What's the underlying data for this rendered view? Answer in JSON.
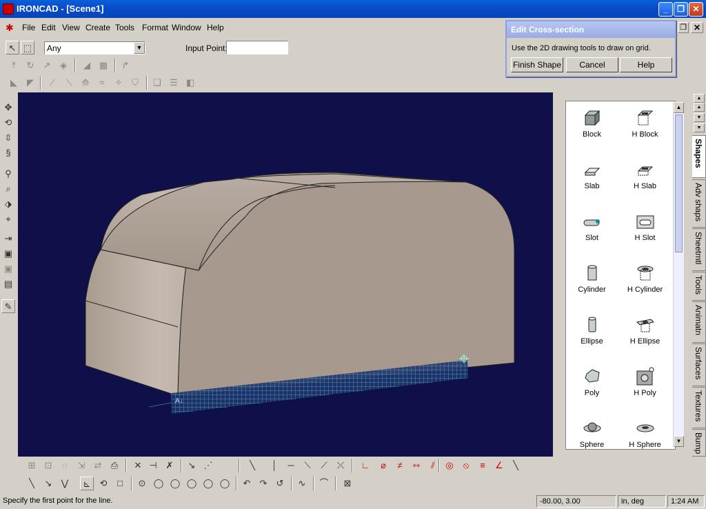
{
  "window": {
    "title": "IRONCAD - [Scene1]",
    "min_icon": "minimize-icon",
    "max_icon": "restore-icon",
    "close_icon": "close-icon"
  },
  "menu": [
    "File",
    "Edit",
    "View",
    "Create",
    "Tools",
    "Format",
    "Window",
    "Help"
  ],
  "selection": {
    "filter_value": "Any",
    "input_point_label": "Input Point:",
    "input_point_value": ""
  },
  "dialog": {
    "title": "Edit Cross-section",
    "message": "Use the 2D drawing tools to draw on grid.",
    "buttons": [
      "Finish Shape",
      "Cancel",
      "Help"
    ]
  },
  "catalog": {
    "items": [
      {
        "label": "Block",
        "icon": "block-icon"
      },
      {
        "label": "H Block",
        "icon": "hollow-block-icon"
      },
      {
        "label": "Slab",
        "icon": "slab-icon"
      },
      {
        "label": "H Slab",
        "icon": "hollow-slab-icon"
      },
      {
        "label": "Slot",
        "icon": "slot-icon"
      },
      {
        "label": "H Slot",
        "icon": "hollow-slot-icon"
      },
      {
        "label": "Cylinder",
        "icon": "cylinder-icon"
      },
      {
        "label": "H Cylinder",
        "icon": "hollow-cylinder-icon"
      },
      {
        "label": "Ellipse",
        "icon": "ellipse-icon"
      },
      {
        "label": "H Ellipse",
        "icon": "hollow-ellipse-icon"
      },
      {
        "label": "Poly",
        "icon": "poly-icon"
      },
      {
        "label": "H Poly",
        "icon": "hollow-poly-icon"
      },
      {
        "label": "Sphere",
        "icon": "sphere-icon"
      },
      {
        "label": "H Sphere",
        "icon": "hollow-sphere-icon"
      }
    ],
    "tabs": [
      "Shapes",
      "Adv shaps",
      "Sheetmtl",
      "Tools",
      "Animatn",
      "Surfaces",
      "Textures",
      "Bump"
    ]
  },
  "viewport": {
    "axis_label": "A↓"
  },
  "status": {
    "message": "Specify the first point for the line.",
    "coords": "-80.00, 3.00",
    "units": "in, deg",
    "time": "1:24 AM"
  },
  "colors": {
    "viewport_bg": "#0f0f4a",
    "model": "#a8998e",
    "grid": "#2f6f7a",
    "titlebar": "#0a5fd8"
  }
}
